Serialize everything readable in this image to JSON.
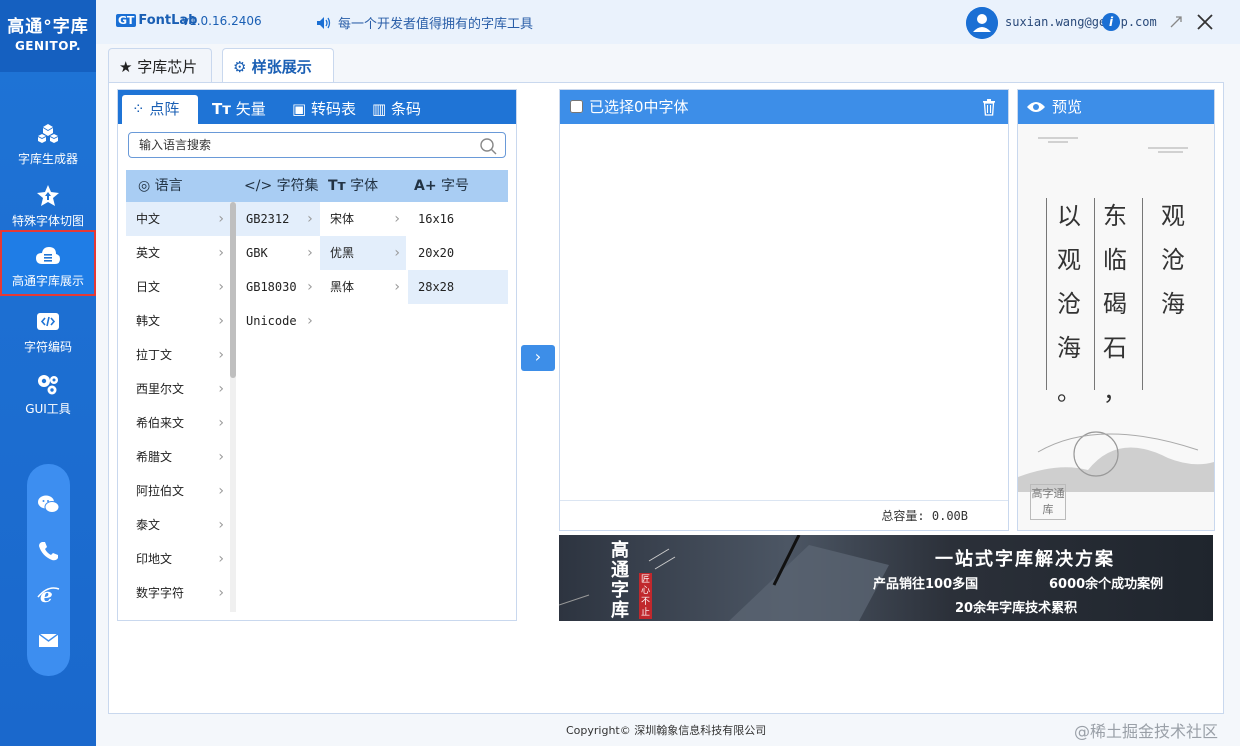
{
  "app": {
    "logo_line1": "高通°字库",
    "logo_line2": "GENITOP."
  },
  "sidebar": {
    "items": [
      {
        "label": "字库生成器",
        "icon": "cubes-icon"
      },
      {
        "label": "特殊字体切图",
        "icon": "star-upload-icon"
      },
      {
        "label": "高通字库展示",
        "icon": "cloud-menu-icon",
        "active": true
      },
      {
        "label": "字符编码",
        "icon": "code-icon"
      },
      {
        "label": "GUI工具",
        "icon": "gears-icon"
      }
    ],
    "contacts": [
      "wechat-icon",
      "phone-icon",
      "ie-icon",
      "mail-icon"
    ]
  },
  "titlebar": {
    "brand": "FontLab",
    "brand_prefix": "GT",
    "version": "v1.0.16.2406",
    "slogan": "每一个开发者值得拥有的字库工具",
    "user_email": "suxian.wang@ge   op.com",
    "info_badge": "i"
  },
  "tabs": {
    "items": [
      {
        "label": "字库芯片",
        "icon": "star-icon"
      },
      {
        "label": "样张展示",
        "icon": "gear-icon",
        "active": true
      }
    ]
  },
  "subtabs": {
    "items": [
      {
        "label": "点阵",
        "icon": "dots-icon",
        "active": true
      },
      {
        "label": "矢量",
        "icon": "text-icon"
      },
      {
        "label": "转码表",
        "icon": "grid-icon"
      },
      {
        "label": "条码",
        "icon": "barcode-icon"
      }
    ]
  },
  "search": {
    "placeholder": "输入语言搜索"
  },
  "columns": {
    "headers": [
      "语言",
      "字符集",
      "字体",
      "字号"
    ],
    "languages": [
      "中文",
      "英文",
      "日文",
      "韩文",
      "拉丁文",
      "西里尔文",
      "希伯来文",
      "希腊文",
      "阿拉伯文",
      "泰文",
      "印地文",
      "数字字符"
    ],
    "charsets": [
      "GB2312",
      "GBK",
      "GB18030",
      "Unicode"
    ],
    "fonts": [
      "宋体",
      "优黑",
      "黑体"
    ],
    "sizes": [
      "16x16",
      "20x20",
      "28x28"
    ]
  },
  "selected": {
    "header": "已选择0中字体",
    "total_label": "总容量: 0.00B"
  },
  "preview": {
    "title": "预览",
    "col1": [
      "观",
      "沧",
      "海"
    ],
    "col2": [
      "东",
      "临",
      "碣",
      "石",
      "，"
    ],
    "col3": [
      "以",
      "观",
      "沧",
      "海",
      "。"
    ],
    "seal": "高字通库"
  },
  "banner": {
    "left_text": "高通字库",
    "seal_text": "匠心不止",
    "title": "一站式字库解决方案",
    "line2a": "产品销往100多国",
    "line2b": "6000余个成功案例",
    "line3": "20余年字库技术累积"
  },
  "footer": {
    "copyright": "Copyright© 深圳翰象信息科技有限公司"
  },
  "watermark": "@稀土掘金技术社区",
  "colors": {
    "primary": "#1f74d6",
    "accent": "#3d8ee8",
    "active_border": "#e53935"
  }
}
